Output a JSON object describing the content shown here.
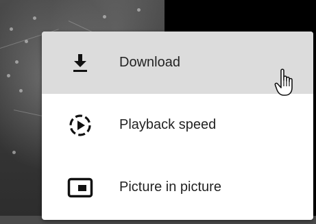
{
  "menu": {
    "items": [
      {
        "label": "Download",
        "icon": "download-icon",
        "state": "hovered"
      },
      {
        "label": "Playback speed",
        "icon": "playback-speed-icon",
        "state": "normal"
      },
      {
        "label": "Picture in picture",
        "icon": "picture-in-picture-icon",
        "state": "normal"
      }
    ]
  },
  "colors": {
    "menu_background": "#ffffff",
    "hover_background": "#dcdcdc",
    "text": "#222222",
    "video_background": "#000000"
  },
  "cursor": {
    "icon": "hand-pointer-icon"
  }
}
